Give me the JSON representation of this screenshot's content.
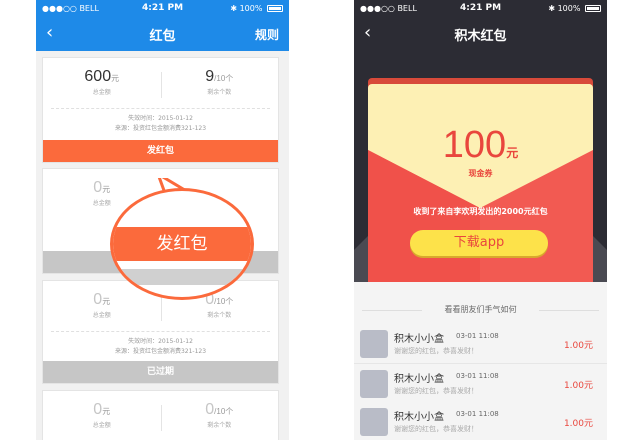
{
  "phone1": {
    "status": {
      "carrier": "●●●○○ BELL",
      "time": "4:21 PM",
      "battery": "100%"
    },
    "nav": {
      "back_icon": "‹",
      "title": "红包",
      "right": "规则"
    },
    "cards": [
      {
        "amount": "600",
        "amount_unit": "元",
        "amount_label": "总金额",
        "count": "9",
        "count_total": "/10个",
        "count_label": "剩余个数",
        "info_line1": "失效时间：2015-01-12",
        "info_line2": "来源：投资红包金额消费321-123",
        "bar_label": "发红包",
        "bar_style": "orange"
      },
      {
        "amount": "0",
        "amount_unit": "元",
        "amount_label": "总金额",
        "count": "",
        "count_total": "",
        "count_label": "",
        "info_line1": "",
        "info_line2": "",
        "bar_label": "",
        "bar_style": "grey"
      },
      {
        "amount": "0",
        "amount_unit": "元",
        "amount_label": "总金额",
        "count": "0",
        "count_total": "/10个",
        "count_label": "剩余个数",
        "info_line1": "失效时间：2015-01-12",
        "info_line2": "来源：投资红包金额消费321-123",
        "bar_label": "已过期",
        "bar_style": "grey"
      },
      {
        "amount": "0",
        "amount_unit": "元",
        "amount_label": "总金额",
        "count": "0",
        "count_total": "/10个",
        "count_label": "剩余个数",
        "info_line1": "",
        "info_line2": "",
        "bar_label": "",
        "bar_style": "grey"
      }
    ],
    "bubble_label": "发红包"
  },
  "phone2": {
    "status": {
      "carrier": "●●●○○ BELL",
      "time": "4:21 PM",
      "battery": "100%"
    },
    "nav": {
      "back_icon": "‹",
      "title": "积木红包"
    },
    "coupon": {
      "amount": "100",
      "unit": "元",
      "label": "现金券"
    },
    "envelope_text": "收到了来自李欢玥发出的2000元红包",
    "download_button": "下载app",
    "friends_title": "看看朋友们手气如何",
    "friends": [
      {
        "name": "积木小小盒",
        "time": "03-01 11:08",
        "message": "谢谢您的红包，恭喜发财！",
        "amount": "1.00元"
      },
      {
        "name": "积木小小盒",
        "time": "03-01 11:08",
        "message": "谢谢您的红包，恭喜发财！",
        "amount": "1.00元"
      },
      {
        "name": "积木小小盒",
        "time": "03-01 11:08",
        "message": "谢谢您的红包，恭喜发财！",
        "amount": "1.00元"
      }
    ]
  },
  "colors": {
    "blue": "#1e8ae8",
    "orange": "#fb6a3c",
    "red": "#e9463d",
    "yellow": "#fde24a",
    "dark": "#2c2c34"
  },
  "icons": {
    "back": "chevron-left-icon",
    "wifi": "wifi-icon",
    "bluetooth": "bluetooth-icon",
    "battery": "battery-icon"
  }
}
